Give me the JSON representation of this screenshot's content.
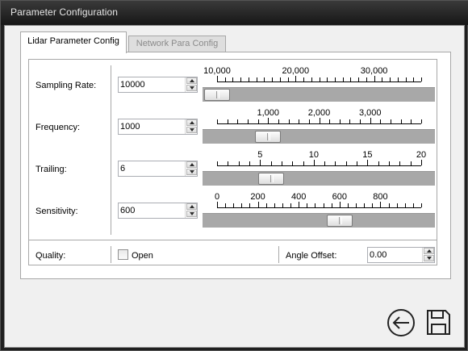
{
  "window": {
    "title": "Parameter Configuration"
  },
  "tabs": [
    {
      "label": "Lidar Parameter Config",
      "active": true
    },
    {
      "label": "Network Para Config",
      "active": false
    }
  ],
  "params": [
    {
      "label": "Sampling Rate:",
      "value": "10000",
      "scale": {
        "min": 10000,
        "max": 36000,
        "ticks": [
          "10,000",
          "20,000",
          "30,000"
        ]
      },
      "slider_value": 10000
    },
    {
      "label": "Frequency:",
      "value": "1000",
      "scale": {
        "min": 0,
        "max": 4000,
        "ticks": [
          "1,000",
          "2,000",
          "3,000"
        ]
      },
      "slider_value": 1000
    },
    {
      "label": "Trailing:",
      "value": "6",
      "scale": {
        "min": 1,
        "max": 20,
        "ticks": [
          "5",
          "10",
          "15",
          "20"
        ]
      },
      "slider_value": 6
    },
    {
      "label": "Sensitivity:",
      "value": "600",
      "scale": {
        "min": 0,
        "max": 1000,
        "ticks": [
          "0",
          "200",
          "400",
          "600",
          "800"
        ]
      },
      "slider_value": 600
    }
  ],
  "quality": {
    "label": "Quality:",
    "checkbox_label": "Open",
    "checked": false
  },
  "angle_offset": {
    "label": "Angle Offset:",
    "value": "0.00"
  },
  "icons": {
    "back": "back-arrow-icon",
    "save": "save-floppy-icon"
  }
}
